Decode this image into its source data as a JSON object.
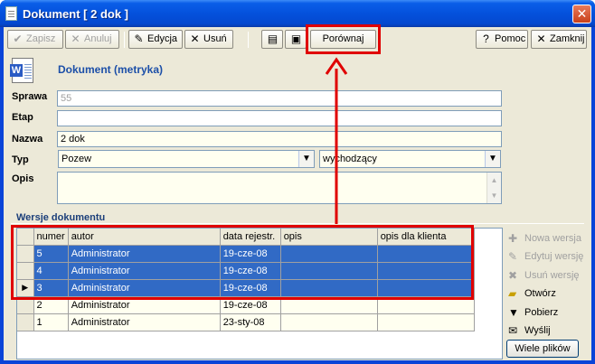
{
  "window": {
    "title": "Dokument [ 2 dok ]",
    "close_glyph": "✕"
  },
  "toolbar": {
    "save_label": "Zapisz",
    "cancel_label": "Anuluj",
    "edit_label": "Edycja",
    "delete_label": "Usuń",
    "compare_label": "Porównaj",
    "help_label": "Pomoc",
    "close_label": "Zamknij"
  },
  "header": {
    "title": "Dokument (metryka)"
  },
  "form": {
    "sprawa_label": "Sprawa",
    "sprawa_value": "55",
    "etap_label": "Etap",
    "etap_value": "",
    "nazwa_label": "Nazwa",
    "nazwa_value": "2 dok",
    "typ_label": "Typ",
    "typ_value": "Pozew",
    "kierunek_value": "wychodzący",
    "opis_label": "Opis",
    "opis_value": ""
  },
  "versions": {
    "title": "Wersje dokumentu",
    "columns": [
      "numer",
      "autor",
      "data rejestr.",
      "opis",
      "opis dla klienta"
    ],
    "rows": [
      {
        "numer": "5",
        "autor": "Administrator",
        "data": "19-cze-08",
        "opis": "",
        "opis_klient": ""
      },
      {
        "numer": "4",
        "autor": "Administrator",
        "data": "19-cze-08",
        "opis": "",
        "opis_klient": ""
      },
      {
        "numer": "3",
        "autor": "Administrator",
        "data": "19-cze-08",
        "opis": "",
        "opis_klient": ""
      },
      {
        "numer": "2",
        "autor": "Administrator",
        "data": "19-cze-08",
        "opis": "",
        "opis_klient": ""
      },
      {
        "numer": "1",
        "autor": "Administrator",
        "data": "23-sty-08",
        "opis": "",
        "opis_klient": ""
      }
    ],
    "current_marker": "▶"
  },
  "side_actions": {
    "new_version": "Nowa wersja",
    "edit_version": "Edytuj wersję",
    "delete_version": "Usuń wersję",
    "open": "Otwórz",
    "download": "Pobierz",
    "send": "Wyślij",
    "many_files": "Wiele plików"
  },
  "colors": {
    "highlight": "#e00000",
    "selection": "#316ac5",
    "title_blue": "#1c4fa8"
  }
}
